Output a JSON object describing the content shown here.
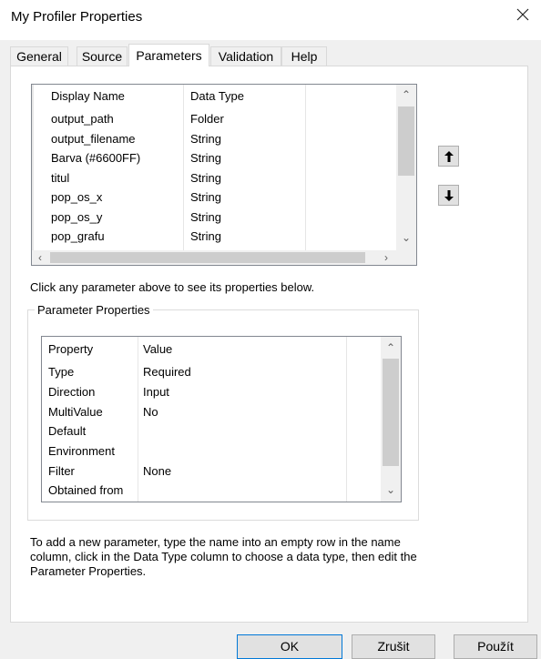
{
  "window": {
    "title": "My Profiler Properties"
  },
  "tabs": [
    {
      "label": "General"
    },
    {
      "label": "Source"
    },
    {
      "label": "Parameters"
    },
    {
      "label": "Validation"
    },
    {
      "label": "Help"
    }
  ],
  "parameters_grid": {
    "headers": [
      "Display Name",
      "Data Type"
    ],
    "rows": [
      {
        "name": "output_path",
        "type": "Folder"
      },
      {
        "name": "output_filename",
        "type": "String"
      },
      {
        "name": "Barva (#6600FF)",
        "type": "String"
      },
      {
        "name": "titul",
        "type": "String"
      },
      {
        "name": "pop_os_x",
        "type": "String"
      },
      {
        "name": "pop_os_y",
        "type": "String"
      },
      {
        "name": "pop_grafu",
        "type": "String"
      }
    ]
  },
  "hint_text": "Click any parameter above to see its properties below.",
  "parameter_properties": {
    "group_label": "Parameter Properties",
    "headers": [
      "Property",
      "Value"
    ],
    "rows": [
      {
        "property": "Type",
        "value": "Required"
      },
      {
        "property": "Direction",
        "value": "Input"
      },
      {
        "property": "MultiValue",
        "value": "No"
      },
      {
        "property": "Default",
        "value": ""
      },
      {
        "property": "Environment",
        "value": ""
      },
      {
        "property": "Filter",
        "value": "None"
      },
      {
        "property": "Obtained from",
        "value": ""
      }
    ]
  },
  "instructions": "To add a new parameter, type the name into an empty row in the name column, click in the Data Type column to choose a data type, then edit the Parameter Properties.",
  "buttons": {
    "ok": "OK",
    "cancel": "Zrušit",
    "apply": "Použít"
  },
  "icons": {
    "close": "close-icon",
    "move_up": "arrow-up-icon",
    "move_down": "arrow-down-icon"
  },
  "colors": {
    "default_button_border": "#0078d7",
    "dialog_background": "#f0f0f0"
  }
}
